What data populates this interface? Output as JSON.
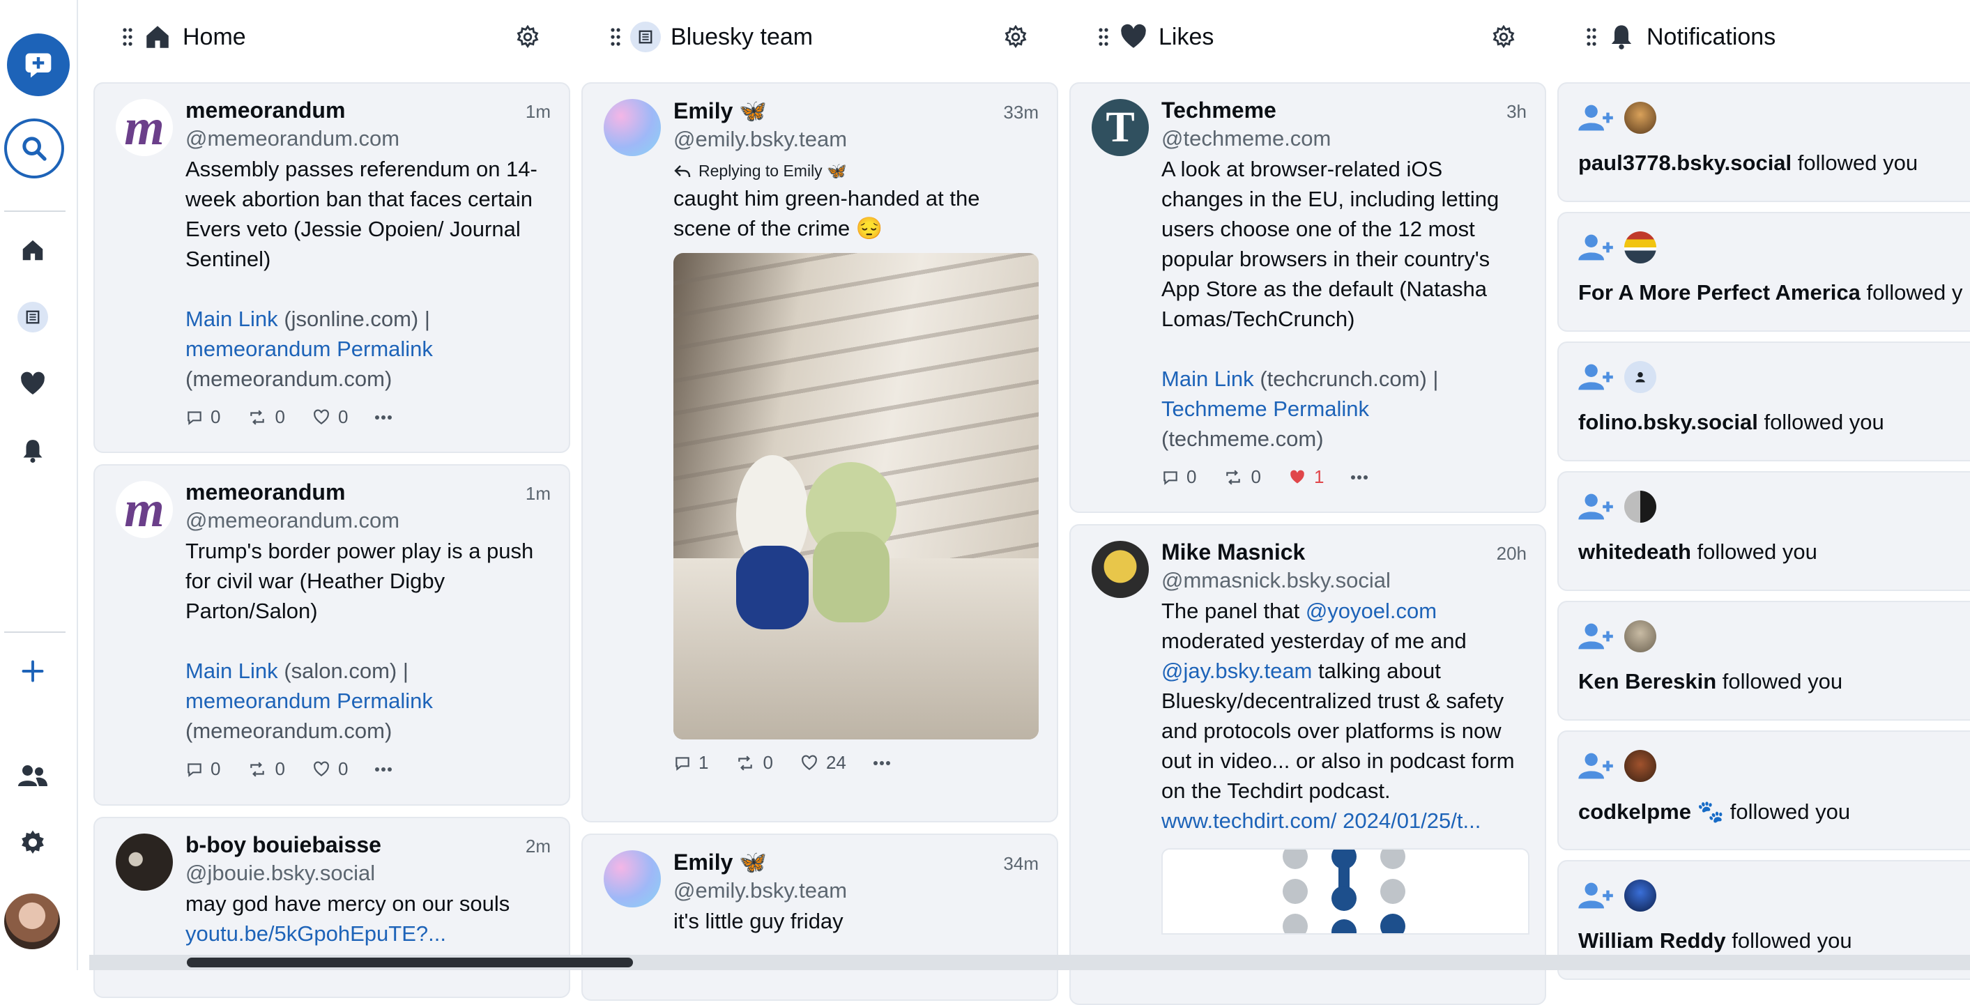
{
  "colors": {
    "accent": "#1d63b8",
    "like": "#e0464a",
    "card": "#f1f3f7"
  },
  "columns": [
    {
      "title": "Home",
      "icon": "home-icon",
      "posts": [
        {
          "name": "memeorandum",
          "time": "1m",
          "handle": "@memeorandum.com",
          "text": "Assembly passes referendum on 14-week abortion ban that faces certain Evers veto (Jessie Opoien/ Journal Sentinel)",
          "link1": "Main Link",
          "link1_domain": "(jsonline.com) |",
          "link2": "memeorandum Permalink",
          "link2_domain": "(memeorandum.com)",
          "replies": "0",
          "reposts": "0",
          "likes": "0"
        },
        {
          "name": "memeorandum",
          "time": "1m",
          "handle": "@memeorandum.com",
          "text": "Trump's border power play is a push for civil war (Heather Digby Parton/Salon)",
          "link1": "Main Link",
          "link1_domain": "(salon.com) |",
          "link2": "memeorandum Permalink",
          "link2_domain": "(memeorandum.com)",
          "replies": "0",
          "reposts": "0",
          "likes": "0"
        },
        {
          "name": "b-boy bouiebaisse",
          "time": "2m",
          "handle": "@jbouie.bsky.social",
          "text": "may god have mercy on our souls",
          "link": "youtu.be/5kGpohEpuTE?..."
        }
      ]
    },
    {
      "title": "Bluesky team",
      "icon": "list-icon",
      "posts": [
        {
          "name": "Emily 🦋",
          "time": "33m",
          "handle": "@emily.bsky.team",
          "reply_to": "Replying to Emily 🦋",
          "text": "caught him green-handed at the scene of the crime 😔",
          "replies": "1",
          "reposts": "0",
          "likes": "24"
        },
        {
          "name": "Emily 🦋",
          "time": "34m",
          "handle": "@emily.bsky.team",
          "text": "it's little guy friday"
        }
      ]
    },
    {
      "title": "Likes",
      "icon": "heart-icon",
      "posts": [
        {
          "name": "Techmeme",
          "time": "3h",
          "handle": "@techmeme.com",
          "text": "A look at browser-related iOS changes in the EU, including letting users choose one of the 12 most popular browsers in their country's App Store as the default (Natasha Lomas/TechCrunch)",
          "link1": "Main Link",
          "link1_domain": "(techcrunch.com) |",
          "link2": "Techmeme Permalink",
          "link2_domain": "(techmeme.com)",
          "replies": "0",
          "reposts": "0",
          "likes": "1"
        },
        {
          "name": "Mike Masnick",
          "time": "20h",
          "handle": "@mmasnick.bsky.social",
          "text_a": "The panel that",
          "mention1": "@yoyoel.com",
          "text_b": "moderated yesterday of me and",
          "mention2": "@jay.bsky.team",
          "text_c": "talking about Bluesky/decentralized trust & safety and protocols over platforms is now out in video... or also in podcast form on the Techdirt podcast.",
          "link": "www.techdirt.com/ 2024/01/25/t..."
        }
      ]
    },
    {
      "title": "Notifications",
      "icon": "bell-icon",
      "items": [
        {
          "user": "paul3778.bsky.social",
          "action": "followed you"
        },
        {
          "user": "For A More Perfect America",
          "action": "followed y"
        },
        {
          "user": "folino.bsky.social",
          "action": "followed you"
        },
        {
          "user": "whitedeath",
          "action": "followed you"
        },
        {
          "user": "Ken Bereskin",
          "action": "followed you"
        },
        {
          "user": "codkelpme 🐾",
          "action": "followed you"
        },
        {
          "user": "William Reddy",
          "action": "followed you"
        }
      ]
    }
  ]
}
